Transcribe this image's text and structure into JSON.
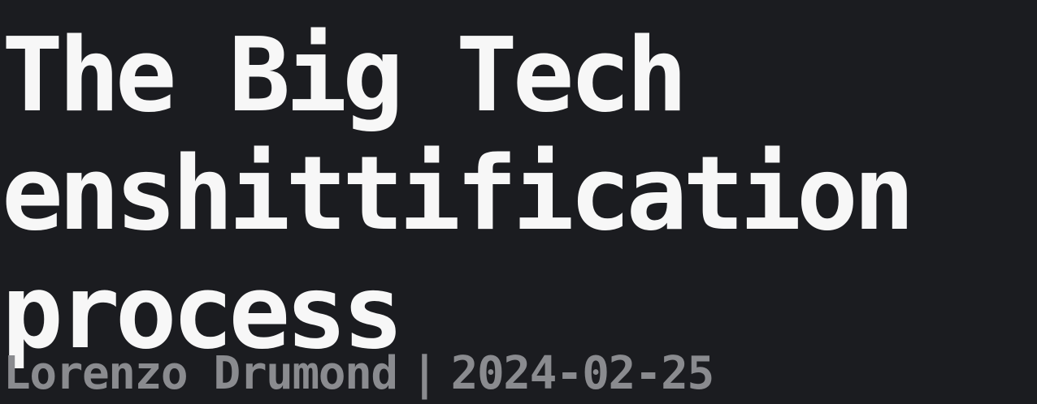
{
  "article": {
    "title_lines": [
      "The Big Tech",
      "enshittification",
      "process"
    ],
    "author": "Lorenzo Drumond",
    "separator": "|",
    "date": "2024-02-25"
  },
  "colors": {
    "background": "#1b1c20",
    "title": "#f7f7f7",
    "byline": "#8a8b8f"
  }
}
